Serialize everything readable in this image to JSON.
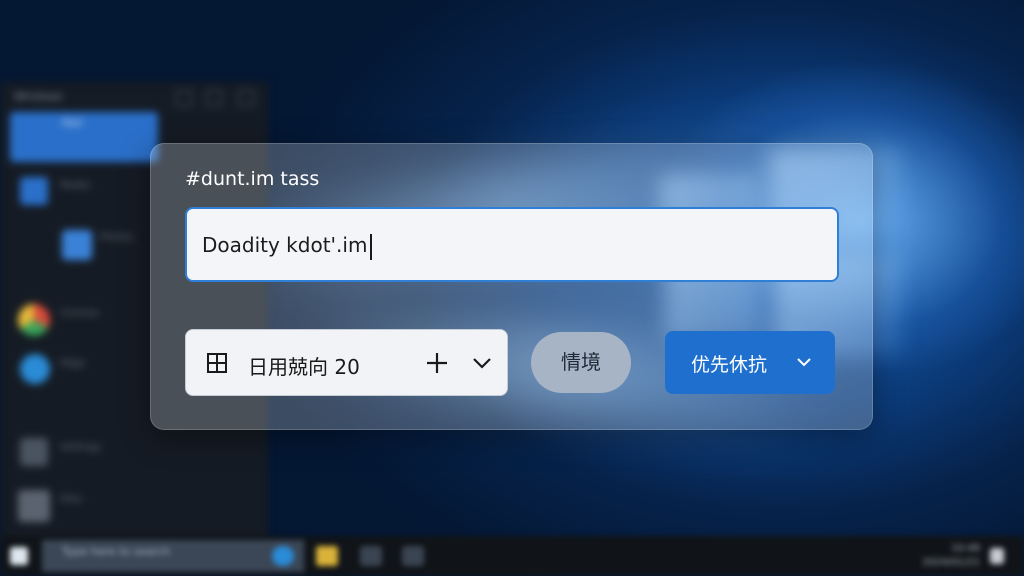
{
  "desktop": {
    "accent": "#1e6fce"
  },
  "start_menu": {
    "header": "Windows",
    "items": [
      {
        "label": "Mail",
        "icon": "mail-icon",
        "color": "#2f7fd6"
      },
      {
        "label": "Media",
        "icon": "play-icon",
        "color": "#2a6fc9"
      },
      {
        "label": "Photos",
        "icon": "photos-icon",
        "color": "#3a82d8"
      },
      {
        "label": "Chrome",
        "icon": "chrome-icon",
        "color": "#d9a13a"
      },
      {
        "label": "Edge",
        "icon": "edge-icon",
        "color": "#2a8bd6"
      },
      {
        "label": "Settings",
        "icon": "gear-icon",
        "color": "#6a7480"
      },
      {
        "label": "Files",
        "icon": "folder-icon",
        "color": "#7a8490"
      }
    ]
  },
  "taskbar": {
    "search_placeholder": "Type here to search",
    "time": "10:48",
    "date": "2024/01/21"
  },
  "dialog": {
    "title": "#dunt.im tass",
    "input_value": "Doadity kdot'.im",
    "date_text": "日用兢向 20",
    "pill_button_label": "情境",
    "primary_button_label": "优先休抗",
    "icons": {
      "calendar": "calendar-icon",
      "plus": "plus-icon",
      "chevron": "chevron-down-icon"
    }
  }
}
